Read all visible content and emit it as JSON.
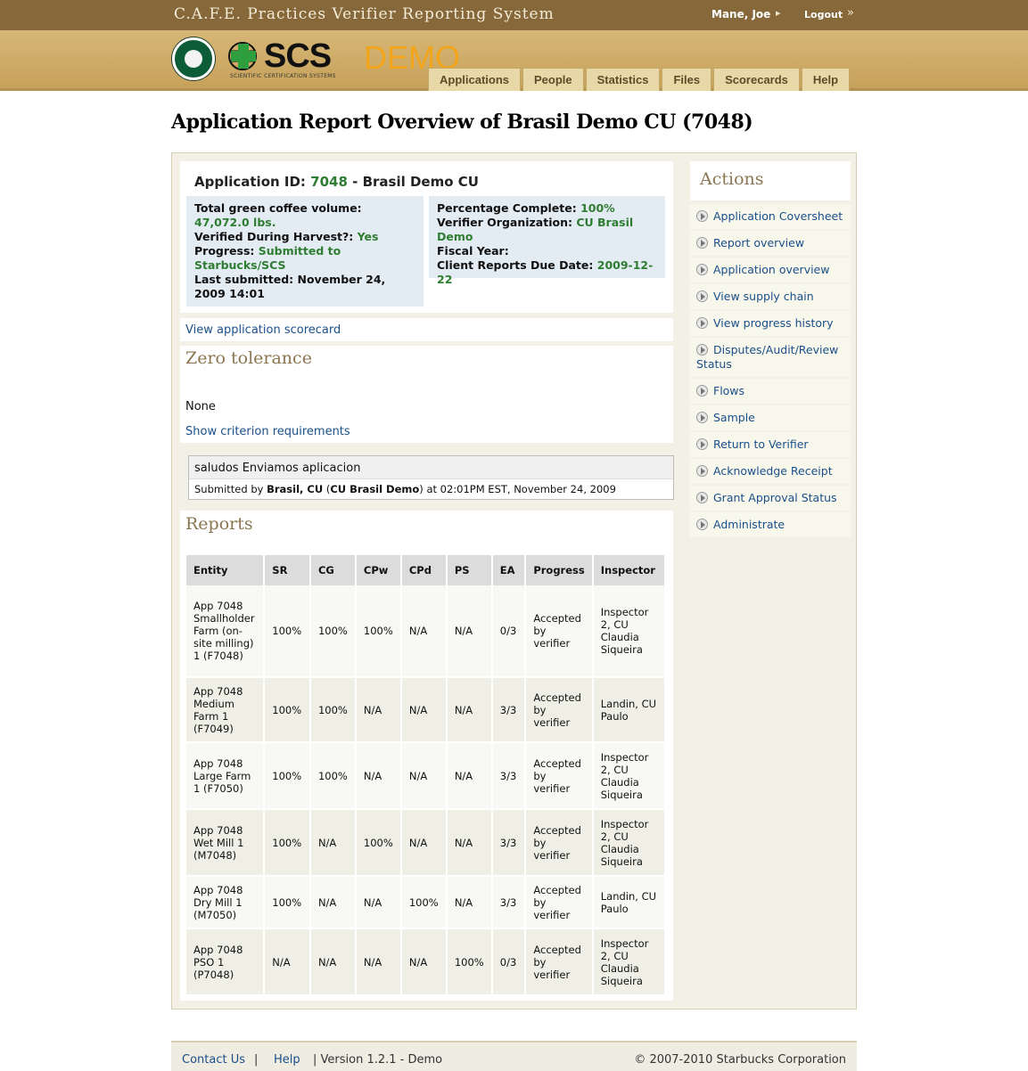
{
  "header": {
    "system_title": "C.A.F.E. Practices Verifier Reporting System",
    "user_name": "Mane, Joe",
    "logout_label": "Logout",
    "demo_label": "DEMO",
    "logo_scs": "SCS",
    "logo_scs_sub": "SCIENTIFIC CERTIFICATION SYSTEMS",
    "logo_starbucks": "STARBUCKS COFFEE"
  },
  "tabs": [
    "Applications",
    "People",
    "Statistics",
    "Files",
    "Scorecards",
    "Help"
  ],
  "page_title": "Application Report Overview of Brasil Demo CU (7048)",
  "application": {
    "id_label": "Application ID: ",
    "id_value": "7048",
    "id_suffix": " - Brasil Demo CU",
    "volume_label": "Total green coffee volume: ",
    "volume_value": "47,072.0 lbs.",
    "harvest_label": "Verified During Harvest?: ",
    "harvest_value": "Yes",
    "progress_label": "Progress: ",
    "progress_value": "Submitted to Starbucks/SCS",
    "submitted_label": "Last submitted: ",
    "submitted_value": "November 24, 2009 14:01",
    "pct_label": "Percentage Complete: ",
    "pct_value": "100%",
    "verifier_label": "Verifier Organization: ",
    "verifier_value": "CU Brasil Demo",
    "fiscal_label": "Fiscal Year:",
    "due_label": "Client Reports Due Date: ",
    "due_value": "2009-12-22"
  },
  "scorecard_link": "View application scorecard",
  "zero_tolerance": {
    "heading": "Zero tolerance",
    "value": "None",
    "link": "Show criterion requirements"
  },
  "note": {
    "message": "saludos Enviamos aplicacion",
    "submitted_prefix": "Submitted by ",
    "submitted_by": "Brasil, CU",
    "org_open": " (",
    "org": "CU Brasil Demo",
    "submitted_suffix": ") at 02:01PM EST, November 24, 2009"
  },
  "reports": {
    "heading": "Reports",
    "columns": [
      "Entity",
      "SR",
      "CG",
      "CPw",
      "CPd",
      "PS",
      "EA",
      "Progress",
      "Inspector"
    ],
    "rows": [
      {
        "entity": "App 7048 Smallholder Farm (on-site milling) 1 (F7048)",
        "sr": "100%",
        "cg": "100%",
        "cpw": "100%",
        "cpd": "N/A",
        "ps": "N/A",
        "ea": "0/3",
        "progress": "Accepted by verifier",
        "inspector": "Inspector 2, CU Claudia Siqueira"
      },
      {
        "entity": "App 7048 Medium Farm 1 (F7049)",
        "sr": "100%",
        "cg": "100%",
        "cpw": "N/A",
        "cpd": "N/A",
        "ps": "N/A",
        "ea": "3/3",
        "progress": "Accepted by verifier",
        "inspector": "Landin, CU Paulo"
      },
      {
        "entity": "App 7048 Large Farm 1 (F7050)",
        "sr": "100%",
        "cg": "100%",
        "cpw": "N/A",
        "cpd": "N/A",
        "ps": "N/A",
        "ea": "3/3",
        "progress": "Accepted by verifier",
        "inspector": "Inspector 2, CU Claudia Siqueira"
      },
      {
        "entity": "App 7048 Wet Mill 1 (M7048)",
        "sr": "100%",
        "cg": "N/A",
        "cpw": "100%",
        "cpd": "N/A",
        "ps": "N/A",
        "ea": "3/3",
        "progress": "Accepted by verifier",
        "inspector": "Inspector 2, CU Claudia Siqueira"
      },
      {
        "entity": "App 7048 Dry Mill 1 (M7050)",
        "sr": "100%",
        "cg": "N/A",
        "cpw": "N/A",
        "cpd": "100%",
        "ps": "N/A",
        "ea": "3/3",
        "progress": "Accepted by verifier",
        "inspector": "Landin, CU Paulo"
      },
      {
        "entity": "App 7048 PSO 1 (P7048)",
        "sr": "N/A",
        "cg": "N/A",
        "cpw": "N/A",
        "cpd": "N/A",
        "ps": "100%",
        "ea": "0/3",
        "progress": "Accepted by verifier",
        "inspector": "Inspector 2, CU Claudia Siqueira"
      }
    ]
  },
  "actions": {
    "title": "Actions",
    "items": [
      "Application Coversheet",
      "Report overview",
      "Application overview",
      "View supply chain",
      "View progress history",
      "Disputes/Audit/Review Status",
      "Flows",
      "Sample",
      "Return to Verifier",
      "Acknowledge Receipt",
      "Grant Approval Status",
      "Administrate"
    ]
  },
  "footer": {
    "contact": "Contact Us",
    "sep": "|",
    "help": "Help",
    "version": "| Version 1.2.1 - Demo",
    "copyright": "© 2007-2010 Starbucks Corporation"
  },
  "colors": {
    "topbar": "#86683a",
    "header_band": "#cfad6a",
    "tab": "#e8d8a8",
    "link": "#1a4f8a",
    "value_green": "#2e7d32",
    "info_box": "#e4ecf3",
    "demo": "#f2a51a"
  },
  "icons": {
    "user_arrow": "triangle-right-icon",
    "logout_arrow": "double-chevron-right-icon",
    "action_bullet": "circle-arrow-icon"
  }
}
